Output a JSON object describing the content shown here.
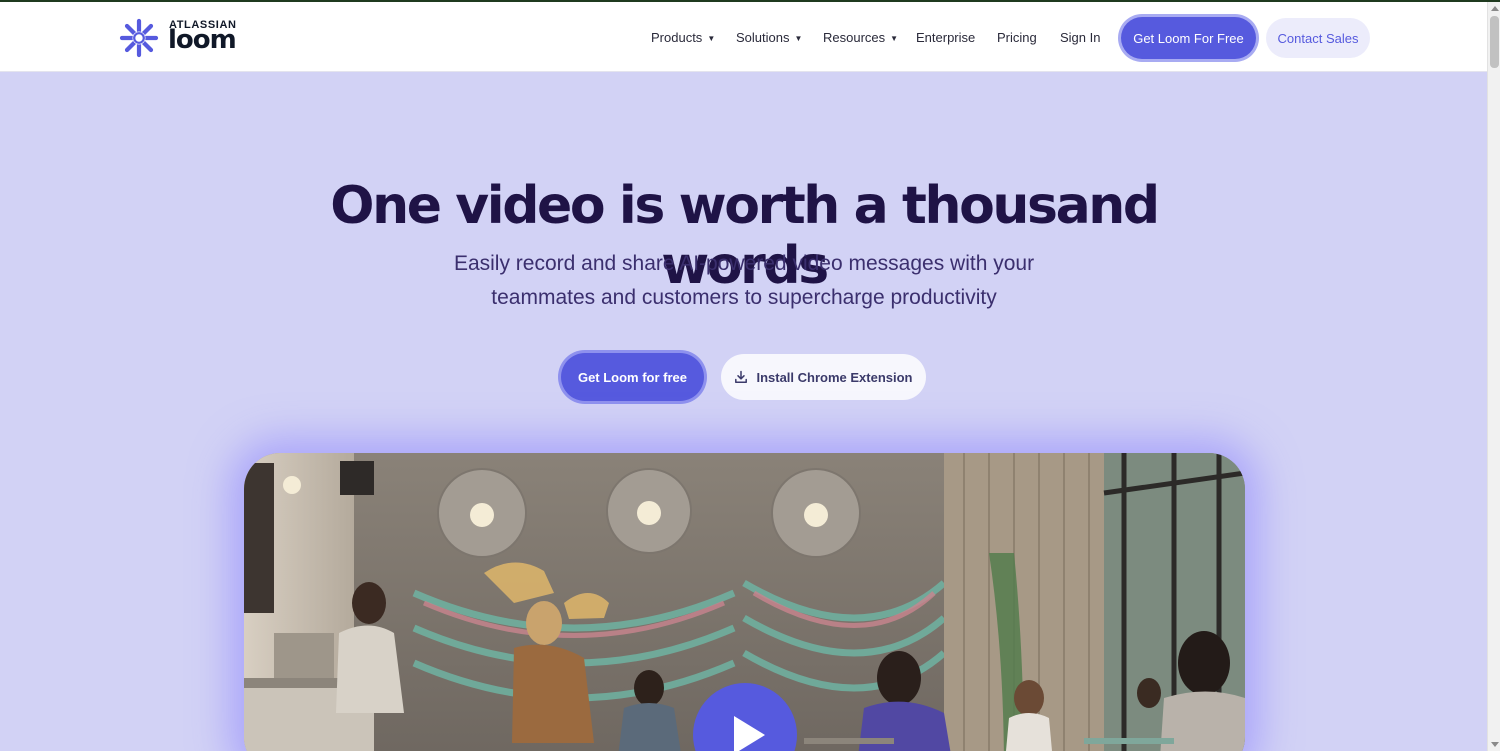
{
  "brand": {
    "company": "ATLASSIAN",
    "product": "loom",
    "logo_icon": "loom-starburst-icon",
    "accent_color": "#565ade"
  },
  "nav": {
    "items": [
      {
        "label": "Products",
        "dropdown": true
      },
      {
        "label": "Solutions",
        "dropdown": true
      },
      {
        "label": "Resources",
        "dropdown": true
      },
      {
        "label": "Enterprise",
        "dropdown": false
      },
      {
        "label": "Pricing",
        "dropdown": false
      },
      {
        "label": "Sign In",
        "dropdown": false
      }
    ],
    "caret": "▼",
    "primary_button": "Get Loom For Free",
    "secondary_button": "Contact Sales"
  },
  "hero": {
    "title": "One video is worth a thousand words",
    "subtitle_line1": "Easily record and share AI-powered video messages with your",
    "subtitle_line2": "teammates and customers to supercharge productivity",
    "cta_primary": "Get Loom for free",
    "cta_secondary": "Install Chrome Extension",
    "cta_secondary_icon": "download-icon"
  },
  "video": {
    "scene": "cafe-workspace-photo",
    "play_icon": "play-icon"
  },
  "colors": {
    "hero_bg": "#d2d2f5",
    "title": "#1f1346",
    "nav_bg": "#ffffff"
  }
}
